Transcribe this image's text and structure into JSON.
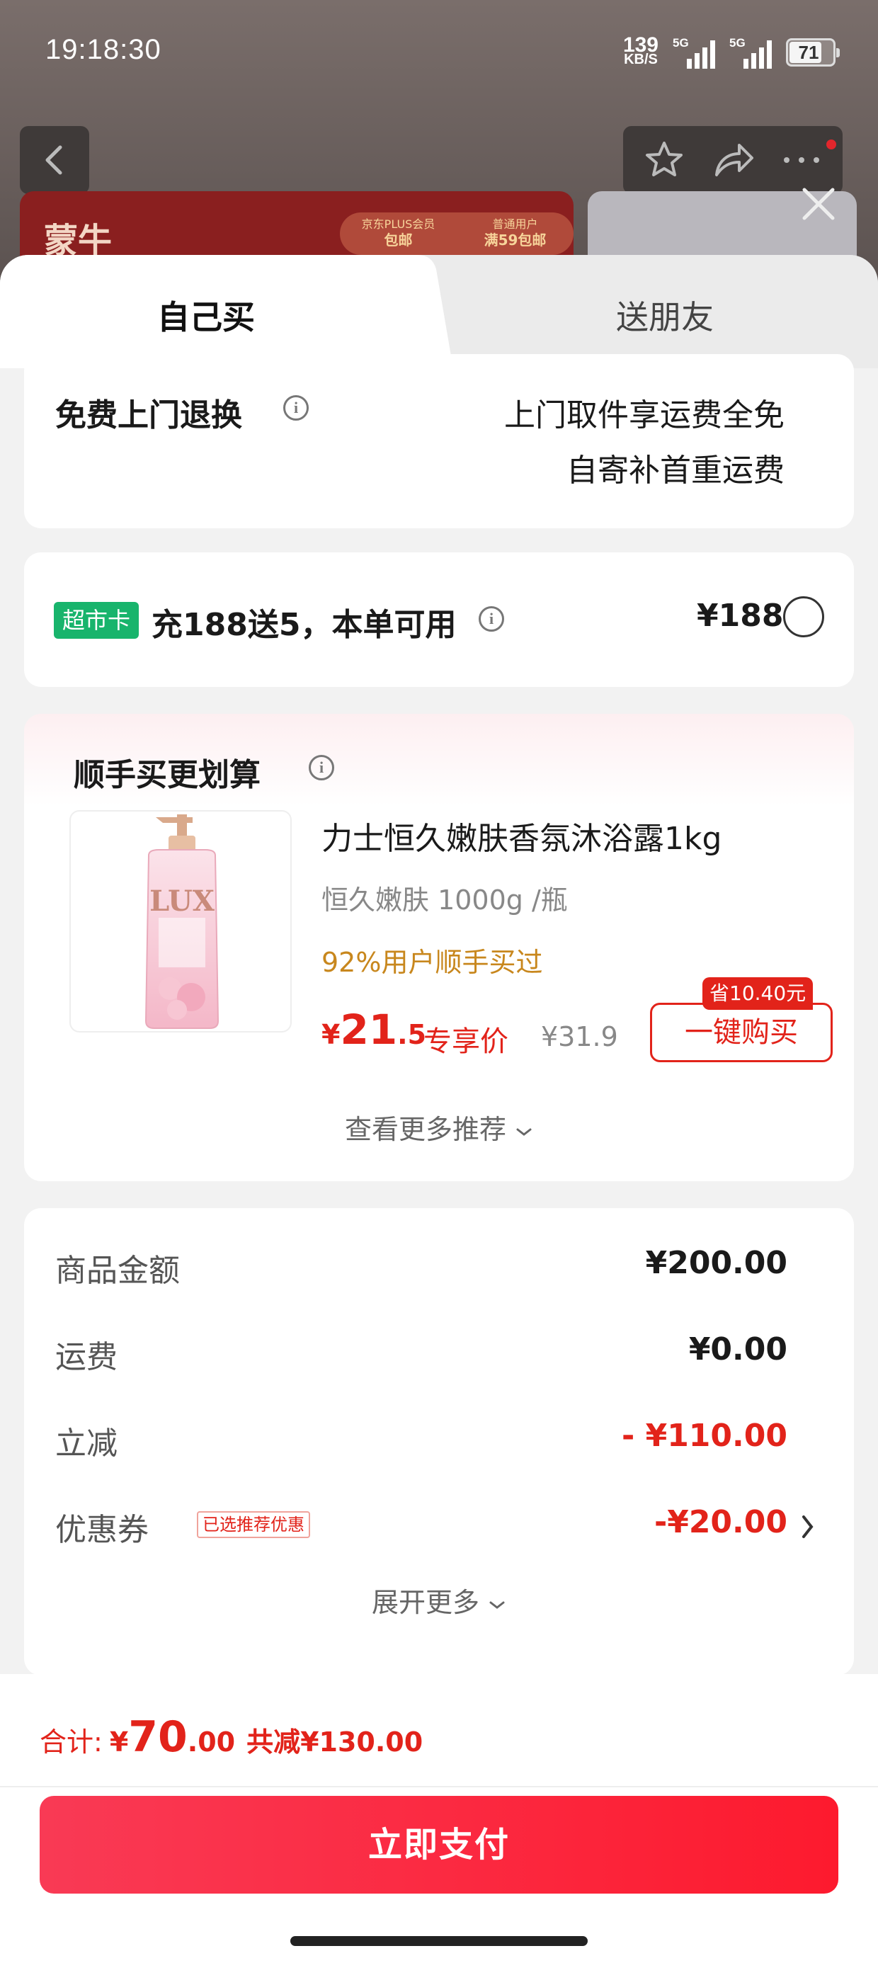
{
  "status_bar": {
    "time": "19:18:30",
    "net_speed_value": "139",
    "net_speed_unit": "KB/S",
    "signal1_label": "5G",
    "signal2_label": "5G",
    "battery": "71"
  },
  "background": {
    "brand_logo": "蒙牛",
    "promo_left": "京东PLUS会员",
    "promo_left_bold": "包邮",
    "promo_right": "普通用户",
    "promo_right_bold": "满59包邮"
  },
  "tabs": {
    "self": "自己买",
    "friend": "送朋友"
  },
  "return_card": {
    "title": "免费上门退换",
    "line1": "上门取件享运费全免",
    "line2": "自寄补首重运费"
  },
  "supermarket_card": {
    "tag": "超市卡",
    "text": "充188送5，本单可用",
    "price": "¥188"
  },
  "recommend_card": {
    "title": "顺手买更划算",
    "product_name": "力士恒久嫩肤香氛沐浴露1kg",
    "product_spec": "恒久嫩肤  1000g /瓶",
    "bought_text": "92%用户顺手买过",
    "price_symbol": "¥",
    "price_int": "21",
    "price_dec": ".5",
    "exclusive_label": "专享价",
    "original_price": "¥31.9",
    "save_badge": "省10.40元",
    "buy_button": "一键购买",
    "more_link": "查看更多推荐",
    "image_brand": "LUX"
  },
  "summary_card": {
    "rows": [
      {
        "label": "商品金额",
        "value": "¥200.00"
      },
      {
        "label": "运费",
        "value": "¥0.00"
      },
      {
        "label": "立减",
        "value": "- ¥110.00"
      },
      {
        "label": "优惠券",
        "value": "-¥20.00",
        "tag": "已选推荐优惠"
      }
    ],
    "expand_more": "展开更多"
  },
  "footer": {
    "total_label": "合计:",
    "total_symbol": "¥",
    "total_int": "70",
    "total_dec": ".00",
    "saved_text": "共减¥130.00",
    "pay_button": "立即支付"
  },
  "colors": {
    "accent_red": "#e2231a",
    "pay_gradient_start": "#f93a55",
    "pay_gradient_end": "#fd1a2e",
    "supermarket_tag_green": "#18b46c",
    "bought_orange": "#c8871d"
  }
}
